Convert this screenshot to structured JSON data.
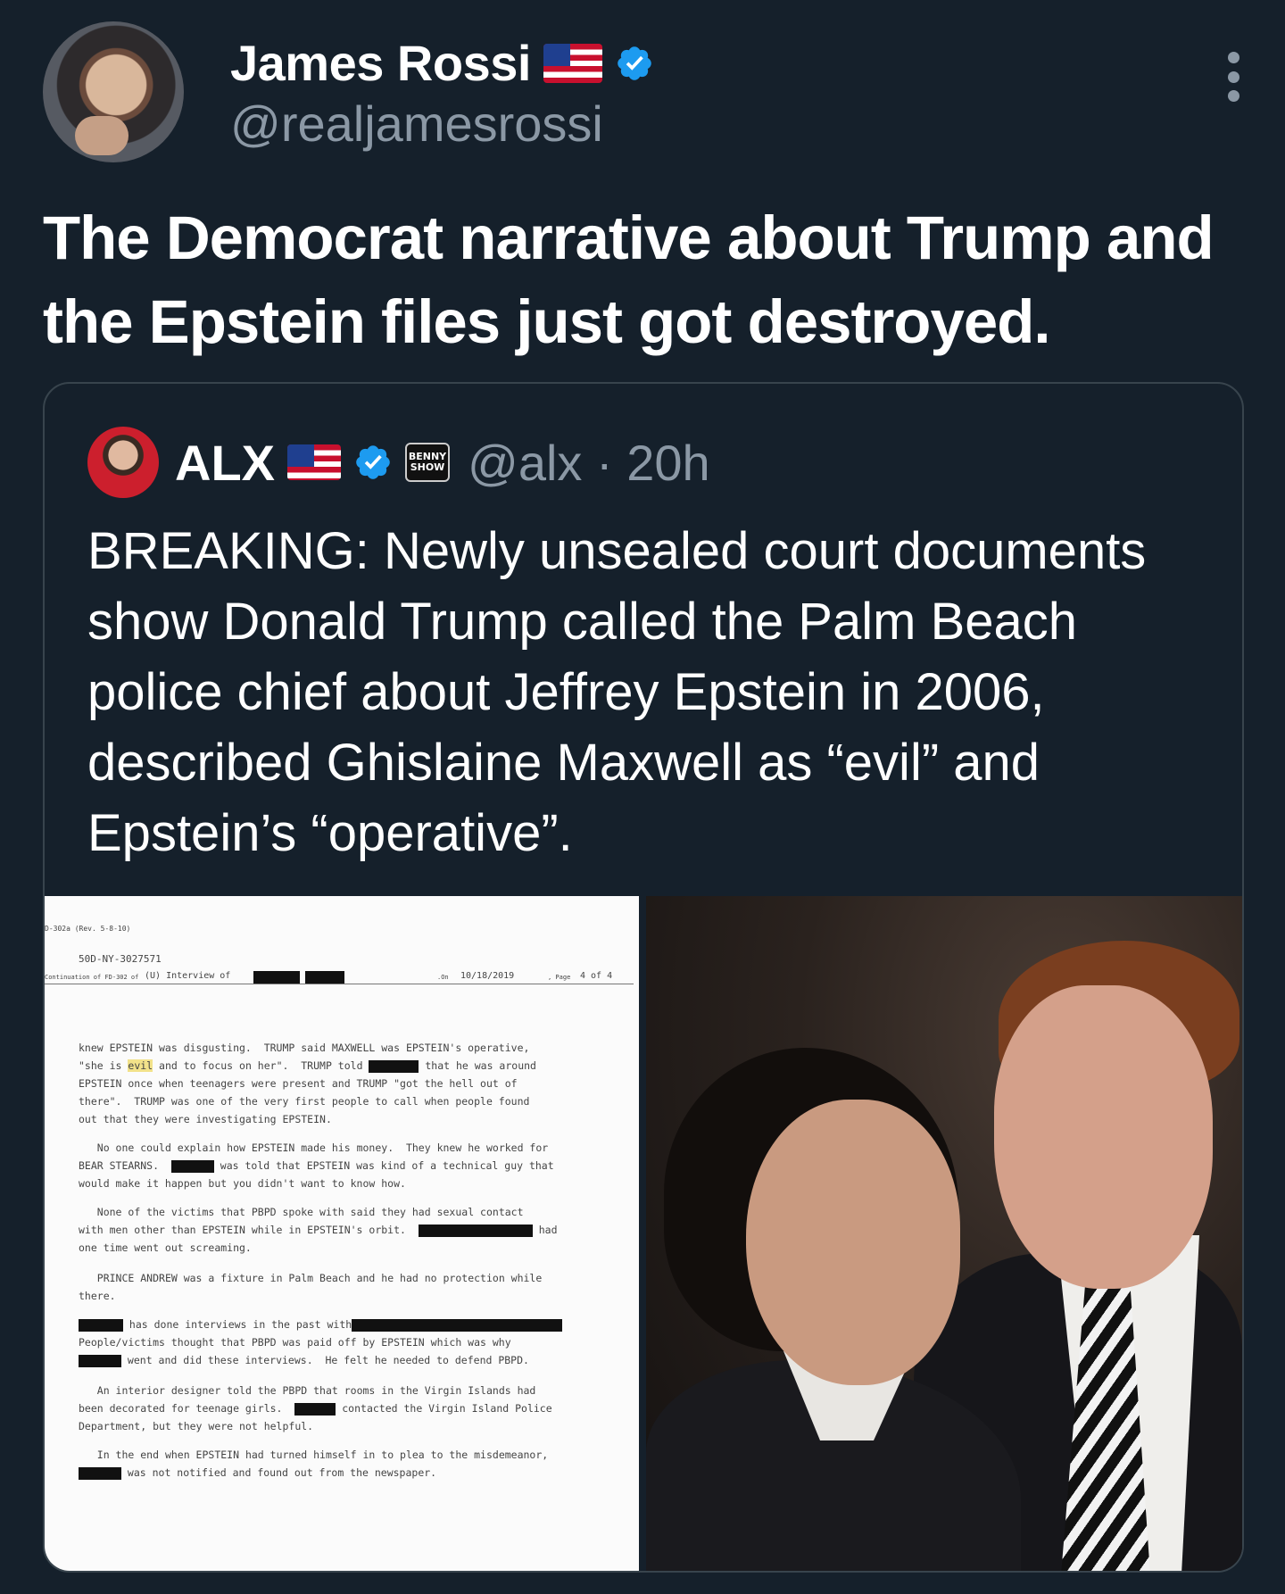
{
  "post": {
    "author_name": "James Rossi",
    "author_handle": "@realjamesrossi",
    "text": "The Democrat narrative about Trump and the Epstein files just got destroyed."
  },
  "quoted": {
    "author_name": "ALX",
    "affiliate_badge": "BENNY SHOW",
    "handle_time": "@alx · 20h",
    "text": "BREAKING: Newly unsealed court documents show Donald Trump called the Palm Beach police chief about Jeffrey Epstein in 2006, described Ghislaine Maxwell as “evil” and Epstein’s “operative”."
  },
  "document": {
    "form": "D-302a (Rev. 5-8-10)",
    "file_no": "50D-NY-3027571",
    "continuation": "Continuation of FD-302 of",
    "interview": "(U) Interview of",
    "on_label": ".On",
    "date": "10/18/2019",
    "page_label": ", Page",
    "page": "4 of 4",
    "p1a": "knew EPSTEIN was disgusting.  TRUMP said MAXWELL was EPSTEIN's operative,",
    "p1b_pre": "\"she is ",
    "p1b_hl": "evil",
    "p1b_mid": " and to focus on her\".  TRUMP told ",
    "p1b_post": " that he was around",
    "p1c": "EPSTEIN once when teenagers were present and TRUMP \"got the hell out of\nthere\".  TRUMP was one of the very first people to call when people found\nout that they were investigating EPSTEIN.",
    "p2a": "   No one could explain how EPSTEIN made his money.  They knew he worked for",
    "p2b_pre": "BEAR STEARNS.  ",
    "p2b_post": " was told that EPSTEIN was kind of a technical guy that",
    "p2c": "would make it happen but you didn't want to know how.",
    "p3a": "   None of the victims that PBPD spoke with said they had sexual contact",
    "p3b_pre": "with men other than EPSTEIN while in EPSTEIN's orbit.  ",
    "p3b_post": " had",
    "p3c": "one time went out screaming.",
    "p4": "   PRINCE ANDREW was a fixture in Palm Beach and he had no protection while\nthere.",
    "p5a_post": " has done interviews in the past with",
    "p5b": "People/victims thought that PBPD was paid off by EPSTEIN which was why",
    "p5c_post": " went and did these interviews.  He felt he needed to defend PBPD.",
    "p6a": "   An interior designer told the PBPD that rooms in the Virgin Islands had",
    "p6b_pre": "been decorated for teenage girls.  ",
    "p6b_post": " contacted the Virgin Island Police",
    "p6c": "Department, but they were not helpful.",
    "p7a": "   In the end when EPSTEIN had turned himself in to plea to the misdemeanor,",
    "p7b_post": " was not notified and found out from the newspaper."
  },
  "colors": {
    "background": "#15202b",
    "secondary_text": "#8b98a5",
    "verified": "#1d9bf0",
    "border": "#38444d"
  },
  "icons": [
    "us-flag-icon",
    "verified-badge-icon",
    "more-options-icon",
    "affiliate-badge-icon"
  ]
}
